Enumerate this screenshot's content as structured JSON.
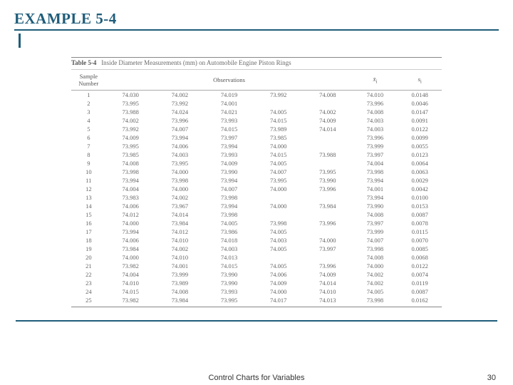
{
  "header": {
    "example_label": "EXAMPLE 5-4"
  },
  "table": {
    "caption_prefix": "Table 5-4",
    "caption_text": "Inside Diameter Measurements (mm) on Automobile Engine Piston Rings",
    "headers": {
      "sample_number": "Sample Number",
      "observations": "Observations",
      "xbar": "x̄ᵢ",
      "s": "sᵢ"
    },
    "rows": [
      {
        "n": "1",
        "obs": [
          "74.030",
          "74.002",
          "74.019",
          "73.992",
          "74.008"
        ],
        "xbar": "74.010",
        "s": "0.0148"
      },
      {
        "n": "2",
        "obs": [
          "73.995",
          "73.992",
          "74.001",
          "",
          ""
        ],
        "xbar": "73.996",
        "s": "0.0046"
      },
      {
        "n": "3",
        "obs": [
          "73.988",
          "74.024",
          "74.021",
          "74.005",
          "74.002"
        ],
        "xbar": "74.008",
        "s": "0.0147"
      },
      {
        "n": "4",
        "obs": [
          "74.002",
          "73.996",
          "73.993",
          "74.015",
          "74.009"
        ],
        "xbar": "74.003",
        "s": "0.0091"
      },
      {
        "n": "5",
        "obs": [
          "73.992",
          "74.007",
          "74.015",
          "73.989",
          "74.014"
        ],
        "xbar": "74.003",
        "s": "0.0122"
      },
      {
        "n": "6",
        "obs": [
          "74.009",
          "73.994",
          "73.997",
          "73.985",
          ""
        ],
        "xbar": "73.996",
        "s": "0.0099"
      },
      {
        "n": "7",
        "obs": [
          "73.995",
          "74.006",
          "73.994",
          "74.000",
          ""
        ],
        "xbar": "73.999",
        "s": "0.0055"
      },
      {
        "n": "8",
        "obs": [
          "73.985",
          "74.003",
          "73.993",
          "74.015",
          "73.988"
        ],
        "xbar": "73.997",
        "s": "0.0123"
      },
      {
        "n": "9",
        "obs": [
          "74.008",
          "73.995",
          "74.009",
          "74.005",
          ""
        ],
        "xbar": "74.004",
        "s": "0.0064"
      },
      {
        "n": "10",
        "obs": [
          "73.998",
          "74.000",
          "73.990",
          "74.007",
          "73.995"
        ],
        "xbar": "73.998",
        "s": "0.0063"
      },
      {
        "n": "11",
        "obs": [
          "73.994",
          "73.998",
          "73.994",
          "73.995",
          "73.990"
        ],
        "xbar": "73.994",
        "s": "0.0029"
      },
      {
        "n": "12",
        "obs": [
          "74.004",
          "74.000",
          "74.007",
          "74.000",
          "73.996"
        ],
        "xbar": "74.001",
        "s": "0.0042"
      },
      {
        "n": "13",
        "obs": [
          "73.983",
          "74.002",
          "73.998",
          "",
          ""
        ],
        "xbar": "73.994",
        "s": "0.0100"
      },
      {
        "n": "14",
        "obs": [
          "74.006",
          "73.967",
          "73.994",
          "74.000",
          "73.984"
        ],
        "xbar": "73.990",
        "s": "0.0153"
      },
      {
        "n": "15",
        "obs": [
          "74.012",
          "74.014",
          "73.998",
          "",
          ""
        ],
        "xbar": "74.008",
        "s": "0.0087"
      },
      {
        "n": "16",
        "obs": [
          "74.000",
          "73.984",
          "74.005",
          "73.998",
          "73.996"
        ],
        "xbar": "73.997",
        "s": "0.0078"
      },
      {
        "n": "17",
        "obs": [
          "73.994",
          "74.012",
          "73.986",
          "74.005",
          ""
        ],
        "xbar": "73.999",
        "s": "0.0115"
      },
      {
        "n": "18",
        "obs": [
          "74.006",
          "74.010",
          "74.018",
          "74.003",
          "74.000"
        ],
        "xbar": "74.007",
        "s": "0.0070"
      },
      {
        "n": "19",
        "obs": [
          "73.984",
          "74.002",
          "74.003",
          "74.005",
          "73.997"
        ],
        "xbar": "73.998",
        "s": "0.0085"
      },
      {
        "n": "20",
        "obs": [
          "74.000",
          "74.010",
          "74.013",
          "",
          ""
        ],
        "xbar": "74.008",
        "s": "0.0068"
      },
      {
        "n": "21",
        "obs": [
          "73.982",
          "74.001",
          "74.015",
          "74.005",
          "73.996"
        ],
        "xbar": "74.000",
        "s": "0.0122"
      },
      {
        "n": "22",
        "obs": [
          "74.004",
          "73.999",
          "73.990",
          "74.006",
          "74.009"
        ],
        "xbar": "74.002",
        "s": "0.0074"
      },
      {
        "n": "23",
        "obs": [
          "74.010",
          "73.989",
          "73.990",
          "74.009",
          "74.014"
        ],
        "xbar": "74.002",
        "s": "0.0119"
      },
      {
        "n": "24",
        "obs": [
          "74.015",
          "74.008",
          "73.993",
          "74.000",
          "74.010"
        ],
        "xbar": "74.005",
        "s": "0.0087"
      },
      {
        "n": "25",
        "obs": [
          "73.982",
          "73.984",
          "73.995",
          "74.017",
          "74.013"
        ],
        "xbar": "73.998",
        "s": "0.0162"
      }
    ]
  },
  "footer": {
    "title": "Control Charts for Variables",
    "page": "30"
  }
}
